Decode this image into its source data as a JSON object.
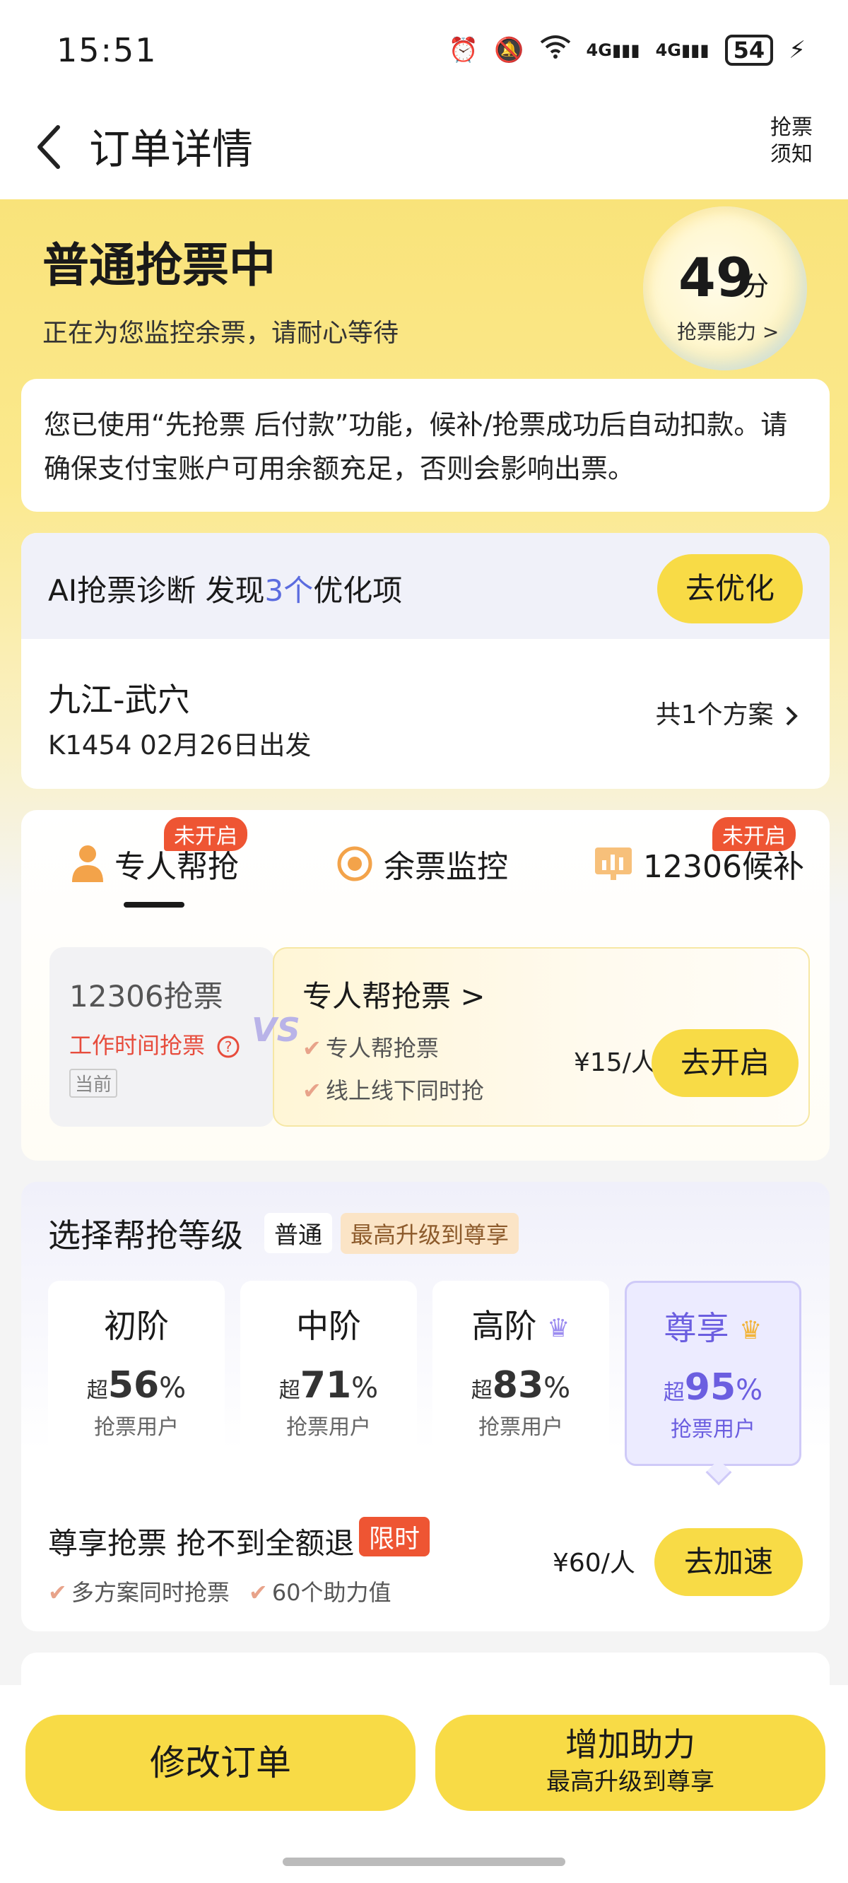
{
  "status_bar": {
    "time": "15:51",
    "battery": "54",
    "net1": "4G",
    "net2": "4G"
  },
  "nav": {
    "title": "订单详情",
    "right_line1": "抢票",
    "right_line2": "须知"
  },
  "hero": {
    "title": "普通抢票中",
    "subtitle": "正在为您监控余票，请耐心等待",
    "score": "49",
    "score_unit": "分",
    "score_label": "抢票能力 >"
  },
  "notice": "您已使用“先抢票 后付款”功能，候补/抢票成功后自动扣款。请确保支付宝账户可用余额充足，否则会影响出票。",
  "ai": {
    "prefix": "AI抢票诊断   发现",
    "count": "3个",
    "suffix": "优化项",
    "button": "去优化",
    "route": "九江-武穴",
    "train": "K1454 02月26日出发",
    "plans": "共1个方案"
  },
  "tabs": [
    {
      "label": "专人帮抢",
      "badge": "未开启"
    },
    {
      "label": "余票监控"
    },
    {
      "label": "12306候补",
      "badge": "未开启"
    }
  ],
  "compare": {
    "left_title": "12306抢票",
    "left_red": "工作时间抢票",
    "left_tag": "当前",
    "vs": "VS",
    "right_title": "专人帮抢票 >",
    "right_items": [
      "专人帮抢票",
      "线上线下同时抢"
    ],
    "price": "¥15/人",
    "button": "去开启"
  },
  "levels": {
    "title": "选择帮抢等级",
    "current": "普通",
    "max": "最高升级到尊享",
    "items": [
      {
        "name": "初阶",
        "pre": "超",
        "pct": "56",
        "suf": "%",
        "sub": "抢票用户"
      },
      {
        "name": "中阶",
        "pre": "超",
        "pct": "71",
        "suf": "%",
        "sub": "抢票用户"
      },
      {
        "name": "高阶",
        "pre": "超",
        "pct": "83",
        "suf": "%",
        "sub": "抢票用户"
      },
      {
        "name": "尊享",
        "pre": "超",
        "pct": "95",
        "suf": "%",
        "sub": "抢票用户"
      }
    ],
    "vip_title": "尊享抢票 抢不到全额退",
    "vip_tag": "限时",
    "vip_items": [
      "多方案同时抢票",
      "60个助力值"
    ],
    "vip_price": "¥60/人",
    "vip_button": "去加速"
  },
  "bottom": {
    "modify": "修改订单",
    "boost": "增加助力",
    "boost_sub": "最高升级到尊享"
  },
  "colors": {
    "accent_yellow": "#f8db46",
    "highlight_blue": "#5b6cdf",
    "red": "#ee5533",
    "vip_purple": "#6b5ee0"
  }
}
